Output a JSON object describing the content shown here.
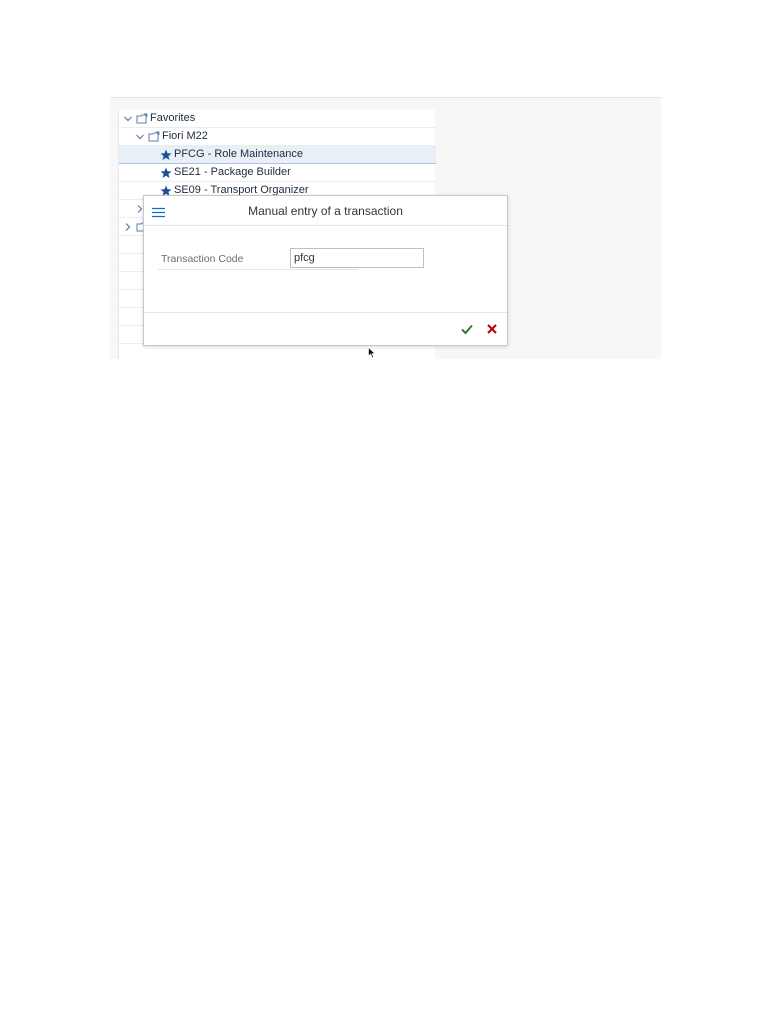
{
  "tree": {
    "items": [
      {
        "label": "Favorites",
        "icon": "folder-icon"
      },
      {
        "label": "Fiori M22",
        "icon": "folder-icon"
      },
      {
        "label": "PFCG - Role Maintenance",
        "icon": "star-icon",
        "selected": true
      },
      {
        "label": "SE21 - Package Builder",
        "icon": "star-icon"
      },
      {
        "label": "SE09 - Transport Organizer",
        "icon": "star-icon"
      }
    ]
  },
  "dialog": {
    "title": "Manual entry of a transaction",
    "field_label": "Transaction Code",
    "field_value": "pfcg"
  },
  "colors": {
    "accent": "#0a6ed1",
    "star": "#1f4f9a",
    "confirm": "#2b7d2b",
    "cancel": "#bb0000",
    "selection": "#e8eff7"
  }
}
